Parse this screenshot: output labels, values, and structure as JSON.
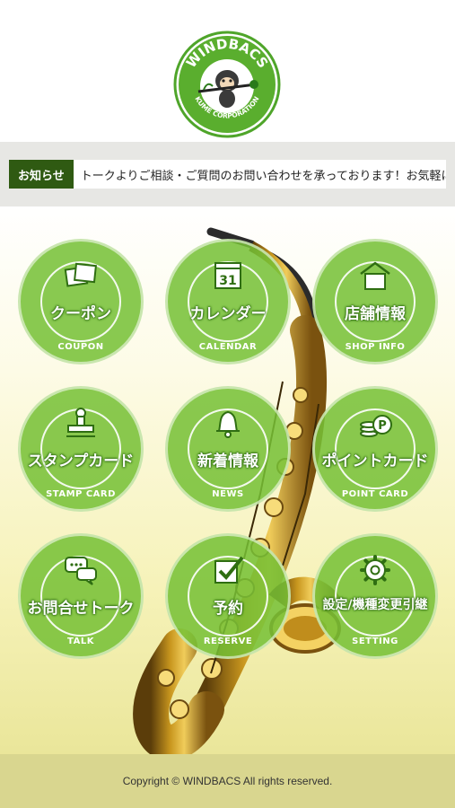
{
  "logo": {
    "top_text": "WINDBACS",
    "bottom_text": "KUME CORPORATION"
  },
  "news": {
    "label": "お知らせ",
    "text": "トークよりご相談・ご質問のお問い合わせを承っております！お気軽にご連絡ください。"
  },
  "menu": [
    {
      "label": "クーポン",
      "sub": "COUPON",
      "icon": "coupon-icon"
    },
    {
      "label": "カレンダー",
      "sub": "CALENDAR",
      "icon": "calendar-icon",
      "icon_text": "31"
    },
    {
      "label": "店舗情報",
      "sub": "SHOP INFO",
      "icon": "shop-icon"
    },
    {
      "label": "スタンプカード",
      "sub": "STAMP CARD",
      "icon": "stamp-icon"
    },
    {
      "label": "新着情報",
      "sub": "NEWS",
      "icon": "bell-icon"
    },
    {
      "label": "ポイントカード",
      "sub": "POINT CARD",
      "icon": "coins-icon",
      "icon_text": "P"
    },
    {
      "label": "お問合せトーク",
      "sub": "TALK",
      "icon": "chat-icon"
    },
    {
      "label": "予約",
      "sub": "RESERVE",
      "icon": "checkmark-icon"
    },
    {
      "label": "設定/機種変更引継",
      "sub": "SETTING",
      "icon": "gear-icon"
    }
  ],
  "footer": {
    "copyright": "Copyright © WINDBACS All rights reserved."
  },
  "colors": {
    "button_green": "#76c036",
    "news_label_bg": "#2f5a12",
    "logo_green": "#4fa52a"
  }
}
